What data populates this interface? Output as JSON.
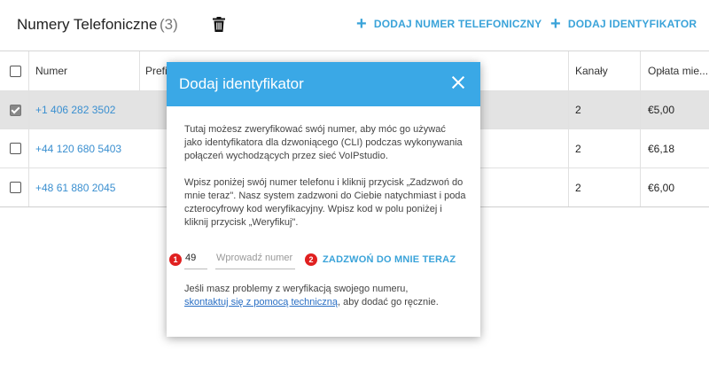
{
  "header": {
    "title": "Numery Telefoniczne",
    "count": "(3)",
    "add_number_label": "DODAJ NUMER TELEFONICZNY",
    "add_identifier_label": "DODAJ IDENTYFIKATOR"
  },
  "table": {
    "columns": [
      "Numer",
      "Prefi",
      "Kanały",
      "Opłata mie..."
    ],
    "rows": [
      {
        "number": "+1 406 282 3502",
        "channels": "2",
        "fee": "€5,00",
        "checked": true
      },
      {
        "number": "+44 120 680 5403",
        "channels": "2",
        "fee": "€6,18",
        "checked": false
      },
      {
        "number": "+48 61 880 2045",
        "channels": "2",
        "fee": "€6,00",
        "checked": false
      }
    ]
  },
  "modal": {
    "title": "Dodaj identyfikator",
    "intro": "Tutaj możesz zweryfikować swój numer, aby móc go używać jako identyfikatora dla dzwoniącego (CLI) podczas wykonywania połączeń wychodzących przez sieć VoIPstudio.",
    "instructions": "Wpisz poniżej swój numer telefonu i kliknij przycisk „Zadzwoń do mnie teraz\". Nasz system zadzwoni do Ciebie natychmiast i poda czterocyfrowy kod weryfikacyjny. Wpisz kod w polu poniżej i kliknij przycisk „Weryfikuj\".",
    "country_code_value": "49",
    "phone_placeholder": "Wprowadź numer",
    "call_button_label": "ZADZWOŃ DO MNIE TERAZ",
    "badge_1": "1",
    "badge_2": "2",
    "help_prefix": "Jeśli masz problemy z weryfikacją swojego numeru,",
    "help_link": "skontaktuj się z pomocą techniczną",
    "help_suffix": ", aby dodać go ręcznie."
  },
  "colors": {
    "accent": "#3aa8e6",
    "link": "#3a8fd0",
    "badge": "#e02020"
  }
}
